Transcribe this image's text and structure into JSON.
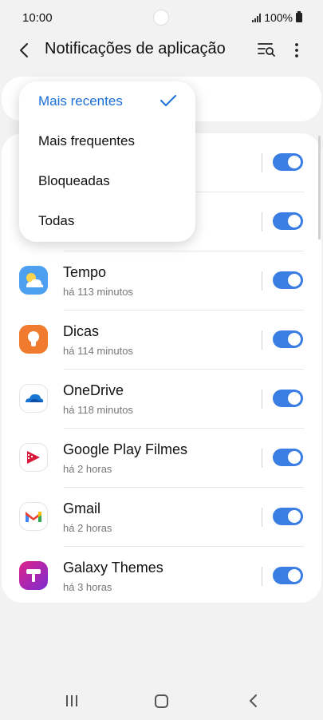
{
  "status_bar": {
    "time": "10:00",
    "battery": "100%"
  },
  "header": {
    "title": "Notificações de aplicação"
  },
  "dropdown": {
    "options": [
      {
        "label": "Mais recentes",
        "selected": true
      },
      {
        "label": "Mais frequentes",
        "selected": false
      },
      {
        "label": "Bloqueadas",
        "selected": false
      },
      {
        "label": "Todas",
        "selected": false
      }
    ]
  },
  "apps": [
    {
      "name": "Tempo",
      "time": "há 113 minutos",
      "icon": "weather-icon",
      "enabled": true
    },
    {
      "name": "Dicas",
      "time": "há 114 minutos",
      "icon": "tips-lightbulb-icon",
      "enabled": true
    },
    {
      "name": "OneDrive",
      "time": "há 118 minutos",
      "icon": "onedrive-cloud-icon",
      "enabled": true
    },
    {
      "name": "Google Play Filmes",
      "time": "há 2 horas",
      "icon": "play-movies-icon",
      "enabled": true
    },
    {
      "name": "Gmail",
      "time": "há 2 horas",
      "icon": "gmail-icon",
      "enabled": true
    },
    {
      "name": "Galaxy Themes",
      "time": "há 3 horas",
      "icon": "galaxy-themes-icon",
      "enabled": true
    }
  ],
  "colors": {
    "accent": "#3a7ee4",
    "selected_text": "#1a6ed8",
    "background": "#f2f2f2"
  }
}
